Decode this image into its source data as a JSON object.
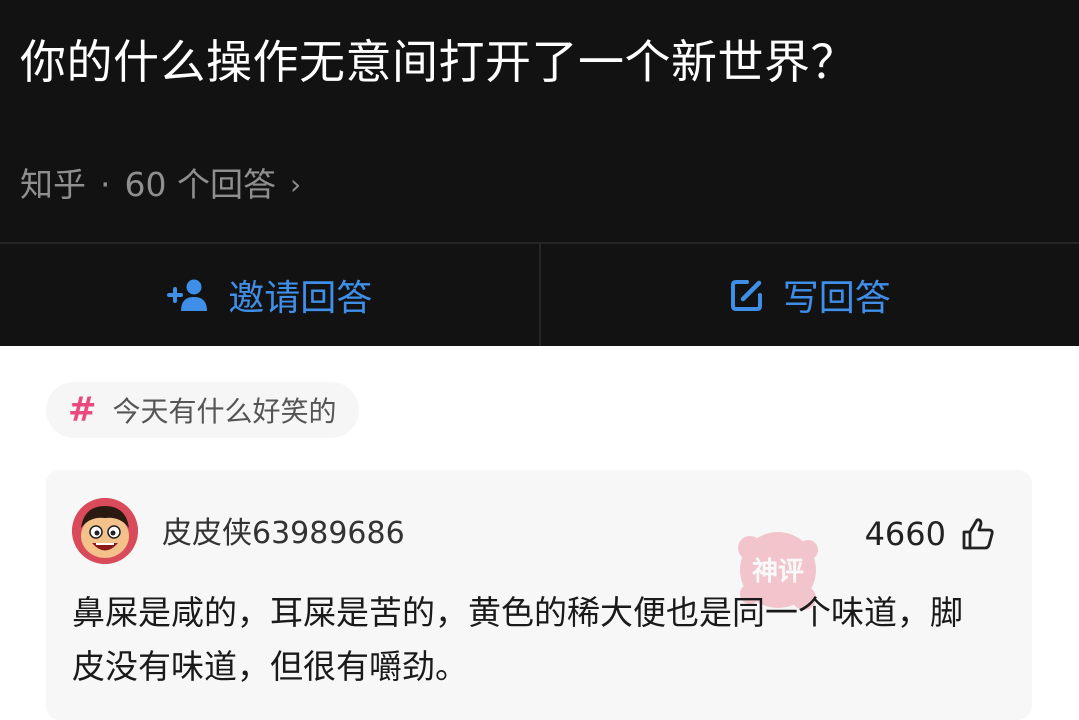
{
  "question": {
    "title": "你的什么操作无意间打开了一个新世界？",
    "source": "知乎",
    "separator": "·",
    "answer_count": "60 个回答",
    "chevron": "›"
  },
  "actions": {
    "invite_label": "邀请回答",
    "write_label": "写回答",
    "accent_color": "#3f8ee8"
  },
  "topic": {
    "hash": "#",
    "label": "今天有什么好笑的"
  },
  "answer": {
    "username": "皮皮侠63989686",
    "likes": "4660",
    "content": "鼻屎是咸的，耳屎是苦的，黄色的稀大便也是同一个味道，脚皮没有味道，但很有嚼劲。",
    "watermark": "神评"
  },
  "icons": {
    "invite": "add-user-icon",
    "write": "edit-icon",
    "like": "thumbs-up-icon",
    "chevron": "chevron-right-icon"
  }
}
